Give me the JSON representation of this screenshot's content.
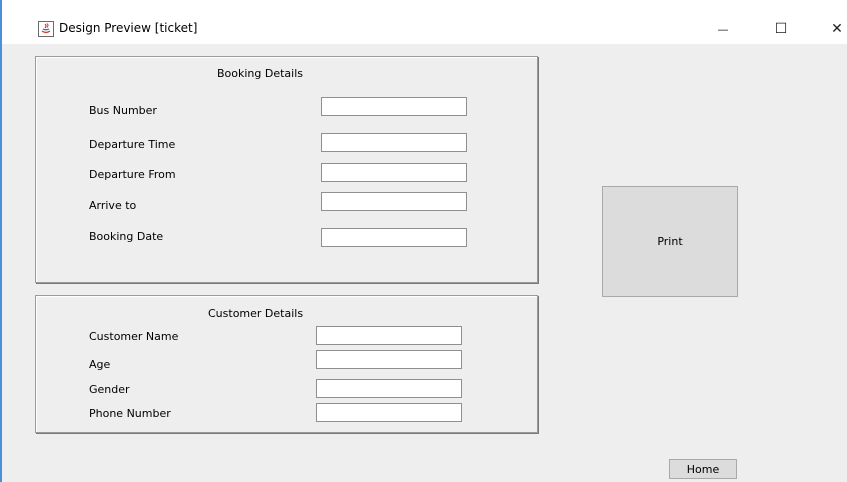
{
  "window": {
    "title": "Design Preview [ticket]",
    "minimize_glyph": "—",
    "maximize_glyph": "☐",
    "close_glyph": "✕"
  },
  "booking": {
    "title": "Booking Details",
    "fields": [
      {
        "label": "Bus Number",
        "value": ""
      },
      {
        "label": "Departure Time",
        "value": ""
      },
      {
        "label": "Departure From",
        "value": ""
      },
      {
        "label": "Arrive to",
        "value": ""
      },
      {
        "label": "Booking Date",
        "value": ""
      }
    ]
  },
  "customer": {
    "title": "Customer Details",
    "fields": [
      {
        "label": "Customer Name",
        "value": ""
      },
      {
        "label": "Age",
        "value": ""
      },
      {
        "label": "Gender",
        "value": ""
      },
      {
        "label": "Phone Number",
        "value": ""
      }
    ]
  },
  "actions": {
    "print_label": "Print",
    "home_label": "Home"
  }
}
